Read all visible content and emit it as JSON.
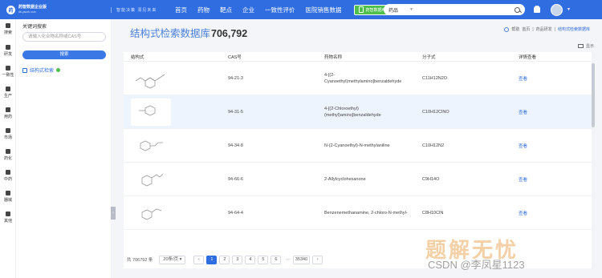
{
  "topbar": {
    "logo_text": "药智数据企业版",
    "logo_sub": "db.yaozh.com",
    "slogan": "智能决策 洞见未来",
    "nav": [
      "首页",
      "药物",
      "靶点",
      "企业",
      "一致性评价",
      "医院销售数据"
    ],
    "app_button": "药智数据APP",
    "search_category": "药品",
    "search_placeholder": ""
  },
  "rail": [
    {
      "label": "搜索",
      "icon": "list-icon"
    },
    {
      "label": "研发",
      "icon": "flask-icon"
    },
    {
      "label": "一致性",
      "icon": "doc-icon"
    },
    {
      "label": "生产",
      "icon": "factory-icon"
    },
    {
      "label": "用药",
      "icon": "pill-icon"
    },
    {
      "label": "市场",
      "icon": "bottle-icon"
    },
    {
      "label": "药化",
      "icon": "molecule-icon"
    },
    {
      "label": "中药",
      "icon": "herb-icon"
    },
    {
      "label": "器械",
      "icon": "syringe-icon"
    },
    {
      "label": "其他",
      "icon": "grid-icon"
    }
  ],
  "sidepanel": {
    "title": "关键词搜索",
    "input_placeholder": "请输入化合物名称或CAS号",
    "search_button": "搜索",
    "structure_link": "结构式检索"
  },
  "page": {
    "title": "结构式检索数据库",
    "count": "706,792",
    "help": "帮助",
    "breadcrumb": [
      "首页",
      "药品研发",
      "结构式检索数据库"
    ],
    "display": "显示"
  },
  "table": {
    "headers": [
      "结构式",
      "CAS号",
      "药物名称",
      "分子式",
      "详情查看"
    ],
    "rows": [
      {
        "cas": "94-21-3",
        "name": "4-[(2-Cyanoethyl)methylamino]benzaldehyde",
        "formula": "C11H12N2O",
        "action": "查看"
      },
      {
        "cas": "94-31-5",
        "name": "4-[(2-Chloroethyl)(methyl)amino]benzaldehyde",
        "formula": "C10H12ClNO",
        "action": "查看"
      },
      {
        "cas": "94-34-8",
        "name": "N-(2-Cyanoethyl)-N-methylaniline",
        "formula": "C10H12N2",
        "action": "查看"
      },
      {
        "cas": "94-66-6",
        "name": "2-Allylcyclohexanone",
        "formula": "C9H14O",
        "action": "查看"
      },
      {
        "cas": "94-64-4",
        "name": "Benzenemethanamine, 2-chloro-N-methyl-",
        "formula": "C8H10ClN",
        "action": "查看"
      }
    ]
  },
  "pager": {
    "total": "共 706792 条",
    "page_size": "20条/页",
    "prev": "‹",
    "pages": [
      "1",
      "2",
      "3",
      "4",
      "5",
      "6"
    ],
    "ellipsis": "···",
    "last": "35340",
    "next": "›"
  },
  "watermark": {
    "big": "题解无忧",
    "small": "CSDN @李凤星1123"
  }
}
